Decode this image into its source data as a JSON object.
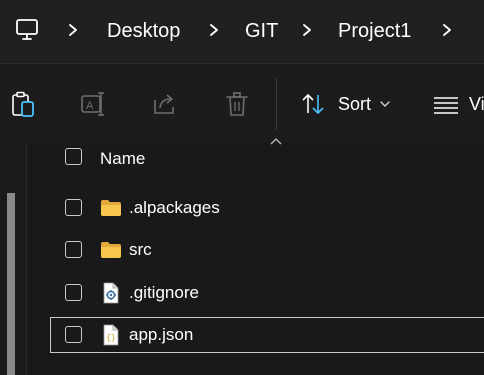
{
  "breadcrumb": {
    "items": [
      "Desktop",
      "GIT",
      "Project1"
    ]
  },
  "commandbar": {
    "sort_label": "Sort",
    "view_label_partial": "Vi"
  },
  "file_list": {
    "header_name": "Name",
    "items": [
      {
        "name": ".alpackages",
        "type": "folder",
        "icon": "folder-icon",
        "selected": false
      },
      {
        "name": "src",
        "type": "folder",
        "icon": "folder-icon",
        "selected": false
      },
      {
        "name": ".gitignore",
        "type": "file",
        "icon": "gear-file-icon",
        "selected": false
      },
      {
        "name": "app.json",
        "type": "file",
        "icon": "json-file-icon",
        "selected": true
      }
    ]
  },
  "colors": {
    "folder": "#F8C64C",
    "accent": "#4CC2FF",
    "background": "#191919"
  }
}
